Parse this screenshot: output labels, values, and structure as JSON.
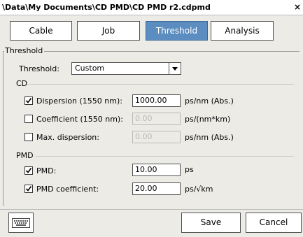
{
  "window": {
    "title": "\\Data\\My Documents\\CD PMD\\CD PMD r2.cdpmd",
    "close_glyph": "×"
  },
  "tabs": [
    {
      "label": "Cable",
      "active": false
    },
    {
      "label": "Job",
      "active": false
    },
    {
      "label": "Threshold",
      "active": true
    },
    {
      "label": "Analysis",
      "active": false
    }
  ],
  "threshold_group": {
    "label": "Threshold",
    "threshold_label": "Threshold:",
    "threshold_value": "Custom"
  },
  "cd": {
    "label": "CD",
    "dispersion": {
      "label": "Dispersion (1550 nm):",
      "checked": true,
      "value": "1000.00",
      "unit": "ps/nm (Abs.)",
      "enabled": true
    },
    "coefficient": {
      "label": "Coefficient (1550 nm):",
      "checked": false,
      "value": "0.00",
      "unit": "ps/(nm*km)",
      "enabled": false
    },
    "max_dispersion": {
      "label": "Max. dispersion:",
      "checked": false,
      "value": "0.00",
      "unit": "ps/nm (Abs.)",
      "enabled": false
    }
  },
  "pmd": {
    "label": "PMD",
    "pmd": {
      "label": "PMD:",
      "checked": true,
      "value": "10.00",
      "unit": "ps",
      "enabled": true
    },
    "pmd_coefficient": {
      "label": "PMD coefficient:",
      "checked": true,
      "value": "20.00",
      "unit": "ps/√km",
      "enabled": true
    }
  },
  "bottom": {
    "keyboard_icon": "keyboard-icon",
    "save_label": "Save",
    "cancel_label": "Cancel"
  },
  "colors": {
    "accent": "#5c8dc0",
    "background": "#ecebe6"
  }
}
